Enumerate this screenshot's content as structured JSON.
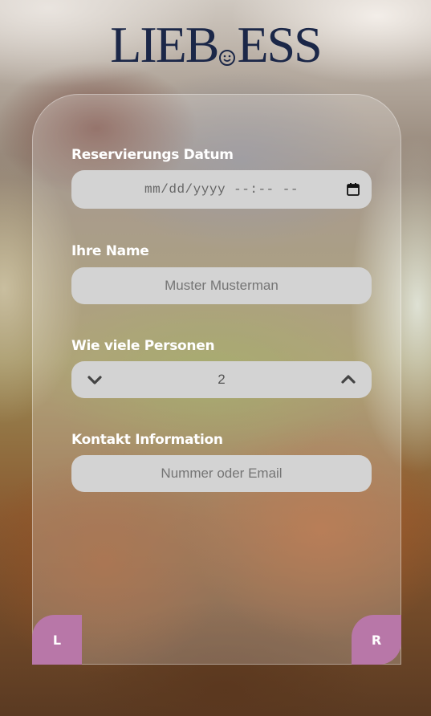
{
  "brand": {
    "name_left": "LIEB",
    "name_right": "ESS"
  },
  "form": {
    "date": {
      "label": "Reservierungs Datum",
      "placeholder": "mm/dd/yyyy --:-- --"
    },
    "name": {
      "label": "Ihre Name",
      "placeholder": "Muster Musterman"
    },
    "persons": {
      "label": "Wie viele Personen",
      "value": "2"
    },
    "contact": {
      "label": "Kontakt Information",
      "placeholder": "Nummer oder Email"
    }
  },
  "buttons": {
    "left": "L",
    "right": "R"
  },
  "colors": {
    "accent": "#b877a8",
    "logo": "#1b2748",
    "field_bg": "#d3d3d3"
  }
}
